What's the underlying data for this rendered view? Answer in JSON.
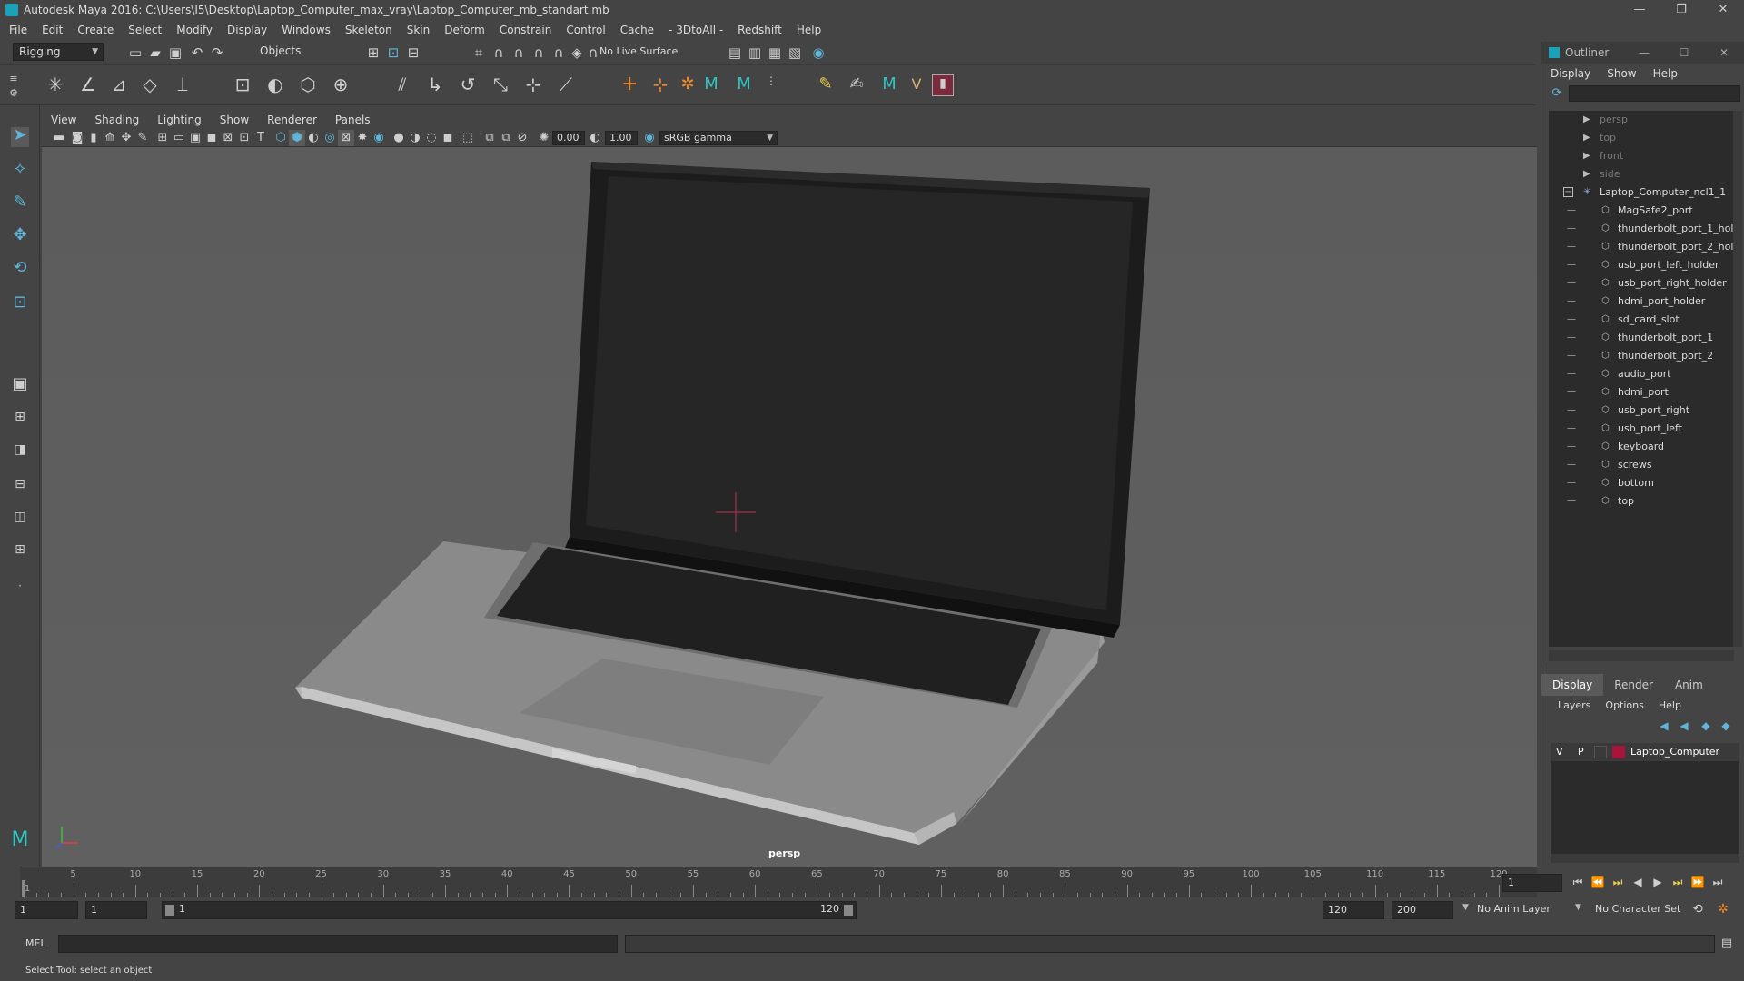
{
  "window": {
    "title": "Autodesk Maya 2016: C:\\Users\\I5\\Desktop\\Laptop_Computer_max_vray\\Laptop_Computer_mb_standart.mb",
    "minimize": "—",
    "restore": "❐",
    "close": "✕"
  },
  "menubar": [
    "File",
    "Edit",
    "Create",
    "Select",
    "Modify",
    "Display",
    "Windows",
    "Skeleton",
    "Skin",
    "Deform",
    "Constrain",
    "Control",
    "Cache",
    "- 3DtoAll -",
    "Redshift",
    "Help"
  ],
  "status_line": {
    "mode": "Rigging",
    "selection_mode": "Objects",
    "live_surface": "No Live Surface"
  },
  "viewport": {
    "menus": [
      "View",
      "Shading",
      "Lighting",
      "Show",
      "Renderer",
      "Panels"
    ],
    "exposure": "0.00",
    "gamma": "1.00",
    "color_space": "sRGB gamma",
    "camera": "persp"
  },
  "outliner": {
    "title": "Outliner",
    "menus": [
      "Display",
      "Show",
      "Help"
    ],
    "cameras": [
      "persp",
      "top",
      "front",
      "side"
    ],
    "group": "Laptop_Computer_ncl1_1",
    "children": [
      "MagSafe2_port",
      "thunderbolt_port_1_hol",
      "thunderbolt_port_2_hol",
      "usb_port_left_holder",
      "usb_port_right_holder",
      "hdmi_port_holder",
      "sd_card_slot",
      "thunderbolt_port_1",
      "thunderbolt_port_2",
      "audio_port",
      "hdmi_port",
      "usb_port_right",
      "usb_port_left",
      "keyboard",
      "screws",
      "bottom",
      "top"
    ]
  },
  "layer_editor": {
    "tabs": [
      "Display",
      "Render",
      "Anim"
    ],
    "active_tab": "Display",
    "menus": [
      "Layers",
      "Options",
      "Help"
    ],
    "layers": [
      {
        "v": "V",
        "p": "P",
        "name": "Laptop_Computer",
        "color": "#a8143a"
      }
    ]
  },
  "timeline": {
    "ticks": [
      5,
      10,
      15,
      20,
      25,
      30,
      35,
      40,
      45,
      50,
      55,
      60,
      65,
      70,
      75,
      80,
      85,
      90,
      95,
      100,
      105,
      110,
      115,
      120
    ],
    "start_tick": "1",
    "current_frame": "1"
  },
  "range": {
    "start": "1",
    "current": "1",
    "slider_start": "1",
    "slider_end": "120",
    "end": "120",
    "max_end": "200",
    "anim_layer": "No Anim Layer",
    "character_set": "No Character Set"
  },
  "command_line": {
    "label": "MEL",
    "help": "Select Tool: select an object"
  },
  "colors": {
    "accent": "#5fb4d8",
    "maya_teal": "#1aa3b8",
    "layer_red": "#a8143a"
  }
}
